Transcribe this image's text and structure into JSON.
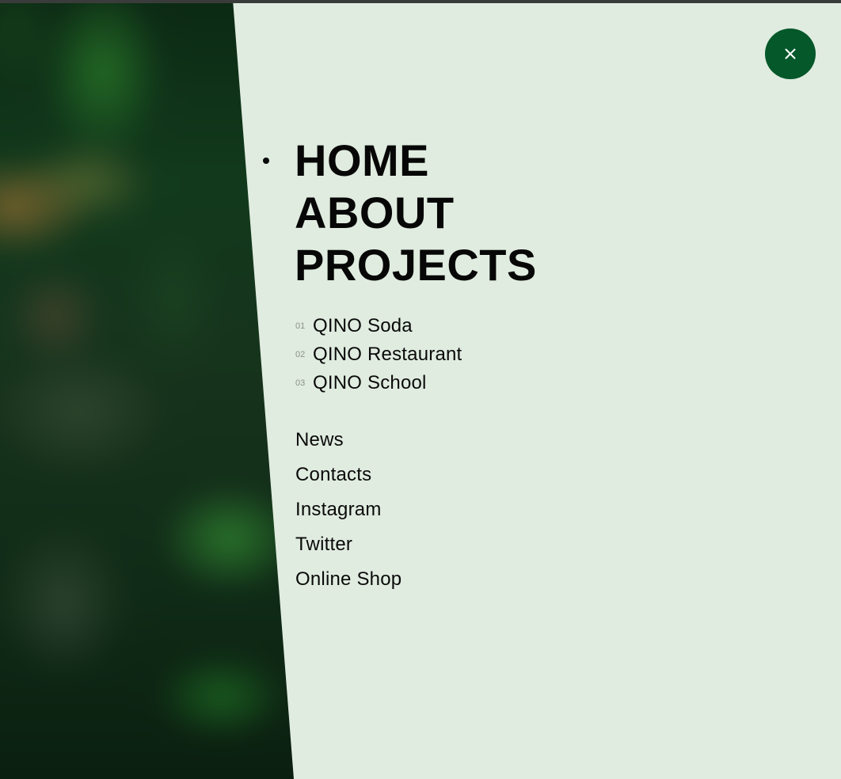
{
  "close_button": {
    "icon": "close-icon",
    "color": "#04582a"
  },
  "main_nav": [
    {
      "label": "HOME",
      "active": true
    },
    {
      "label": "ABOUT"
    },
    {
      "label": "PROJECTS"
    }
  ],
  "projects": [
    {
      "num": "01",
      "name": "QINO Soda"
    },
    {
      "num": "02",
      "name": "QINO Restaurant"
    },
    {
      "num": "03",
      "name": "QINO School"
    }
  ],
  "secondary_nav": [
    "News",
    "Contacts",
    "Instagram",
    "Twitter",
    "Online Shop"
  ],
  "colors": {
    "panel_background": "#e0ece0",
    "accent": "#04582a",
    "text": "#0a0a0a",
    "muted": "#8a928a"
  }
}
